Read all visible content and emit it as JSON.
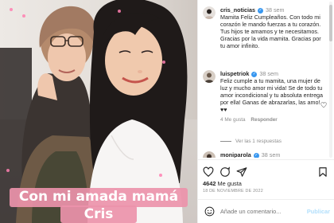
{
  "post": {
    "caption_line1": "Con mi amada mamá",
    "caption_line2": "Cris"
  },
  "comments": [
    {
      "username": "cris_noticias",
      "time": "38 sem",
      "text": "Mamita Feliz Cumpleaños. Con todo mi corazón le mando fuerzas a tu corazón. Tus hijos te amamos y te necesitamos. Gracias por la vida mamita. Gracias por tu amor infinito."
    },
    {
      "username": "luispetriok",
      "time": "38 sem",
      "text": "Feliz cumple a tu mamita, una mujer de luz y mucho amor mi vida! Se de todo tu amor incondicional y tu absoluta entrega por ella! Ganas de abrazarlas, las amo! ♥♥",
      "likes": "4 Me gusta",
      "reply_label": "Responder",
      "view_replies": "Ver las 1 respuestas"
    },
    {
      "username": "moniparola",
      "time": "38 sem"
    }
  ],
  "footer": {
    "likes_count": "4642",
    "likes_label": "Me gusta",
    "date": "18 DE NOVIEMBRE DE 2022",
    "comment_placeholder": "Añade un comentario...",
    "post_button": "Publicar"
  },
  "icons": [
    "verified-badge-icon",
    "heart-icon",
    "comment-icon",
    "share-icon",
    "bookmark-icon",
    "emoji-icon"
  ],
  "colors": {
    "caption_bg": "#EC92AA",
    "verified": "#3897F0",
    "post_button_disabled": "#B2DFFC",
    "muted_text": "#8E8E8E"
  }
}
